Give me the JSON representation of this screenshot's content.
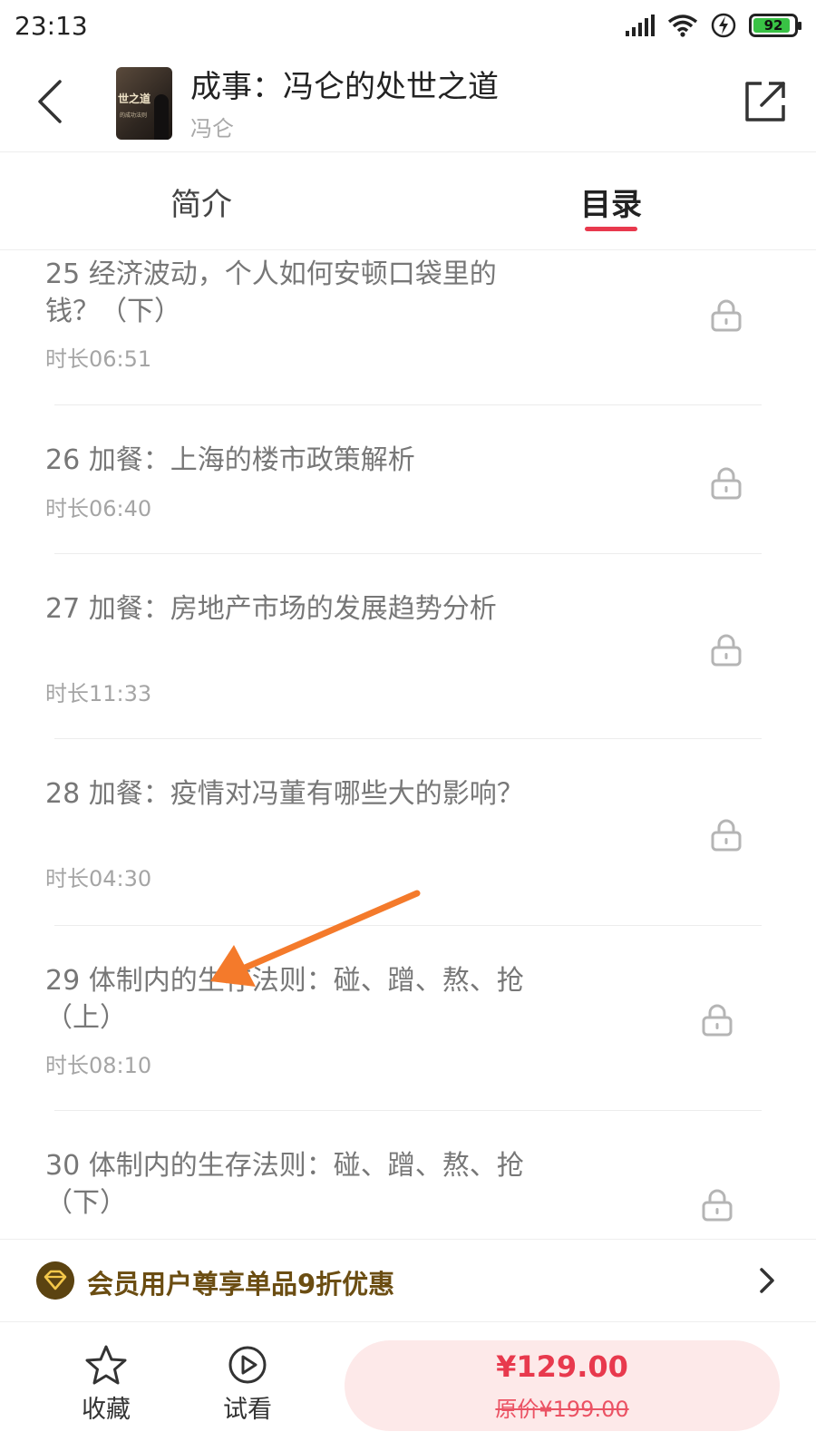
{
  "status_bar": {
    "time": "23:13",
    "battery": "92",
    "battery_fraction": 0.92
  },
  "header": {
    "title": "成事：冯仑的处世之道",
    "author": "冯仑",
    "cover_text": "世之道",
    "cover_sub": "的成功法则"
  },
  "tabs": [
    {
      "label": "简介",
      "active": false
    },
    {
      "label": "目录",
      "active": true
    }
  ],
  "chapters": [
    {
      "title": "25 经济波动，个人如何安顿口袋里的钱？（下）",
      "duration": "时长06:51",
      "locked": true
    },
    {
      "title": "26 加餐：上海的楼市政策解析",
      "duration": "时长06:40",
      "locked": true
    },
    {
      "title": "27 加餐：房地产市场的发展趋势分析",
      "duration": "时长11:33",
      "locked": true
    },
    {
      "title": "28 加餐：疫情对冯董有哪些大的影响？",
      "duration": "时长04:30",
      "locked": true
    },
    {
      "title": "29 体制内的生存法则：碰、蹭、熬、抢（上）",
      "duration": "时长08:10",
      "locked": true
    },
    {
      "title": "30 体制内的生存法则：碰、蹭、熬、抢（下）",
      "duration": "",
      "locked": true
    }
  ],
  "member_banner": {
    "text": "会员用户尊享单品9折优惠"
  },
  "bottom_bar": {
    "favorite_label": "收藏",
    "trial_label": "试看",
    "price": "¥129.00",
    "original_price": "原价¥199.00"
  },
  "colors": {
    "accent": "#e8394d",
    "member_gold": "#6b4d12",
    "annotation_arrow": "#f47a2b"
  },
  "icons": [
    "back-icon",
    "share-icon",
    "lock-icon",
    "member-icon",
    "chevron-right-icon",
    "star-icon",
    "play-circle-icon"
  ]
}
